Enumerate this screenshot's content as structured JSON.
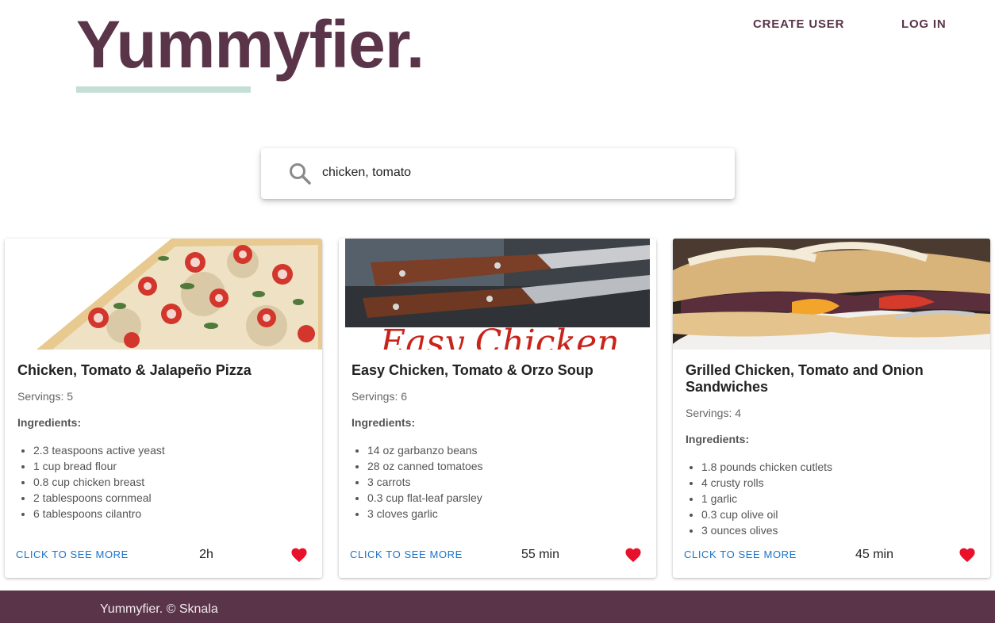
{
  "brand": {
    "logo_text": "Yummyfier.",
    "primary_color": "#5a3448",
    "accent_color": "#c4e0d6",
    "link_color": "#1a73c8",
    "heart_color": "#e8102a"
  },
  "nav": {
    "create_user": "CREATE USER",
    "log_in": "LOG IN"
  },
  "search": {
    "value": "chicken, tomato",
    "icon": "search-icon"
  },
  "cards": [
    {
      "title": "Chicken, Tomato & Jalapeño Pizza",
      "servings": "Servings: 5",
      "ingredients_label": "Ingredients:",
      "ingredients": [
        "2.3 teaspoons active yeast",
        "1 cup bread flour",
        "0.8 cup chicken breast",
        "2 tablespoons cornmeal",
        "6 tablespoons cilantro"
      ],
      "see_more": "CLICK TO SEE MORE",
      "time": "2h",
      "favorite": true
    },
    {
      "title": "Easy Chicken, Tomato & Orzo Soup",
      "servings": "Servings: 6",
      "ingredients_label": "Ingredients:",
      "ingredients": [
        "14 oz garbanzo beans",
        "28 oz canned tomatoes",
        "3 carrots",
        "0.3 cup flat-leaf parsley",
        "3 cloves garlic"
      ],
      "image_caption": "Easy Chicken",
      "see_more": "CLICK TO SEE MORE",
      "time": "55 min",
      "favorite": true
    },
    {
      "title": "Grilled Chicken, Tomato and Onion Sandwiches",
      "servings": "Servings: 4",
      "ingredients_label": "Ingredients:",
      "ingredients": [
        "1.8 pounds chicken cutlets",
        "4 crusty rolls",
        "1 garlic",
        "0.3 cup olive oil",
        "3 ounces olives"
      ],
      "see_more": "CLICK TO SEE MORE",
      "time": "45 min",
      "favorite": true
    }
  ],
  "footer": {
    "text": "Yummyfier. © Sknala"
  }
}
